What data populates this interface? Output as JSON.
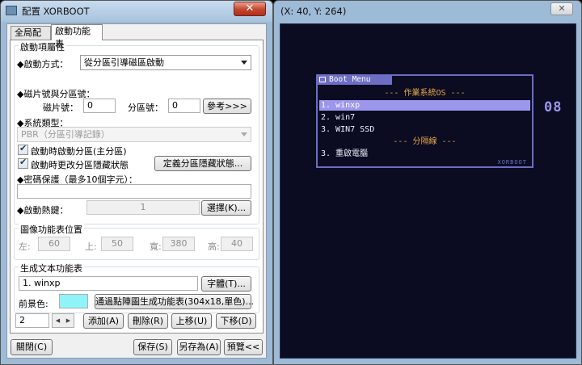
{
  "left_window": {
    "title": "配置 XORBOOT",
    "close_glyph": "✕",
    "tabs": [
      {
        "label": "全局配置",
        "active": false
      },
      {
        "label": "啟動功能表",
        "active": true
      }
    ],
    "boot_props": {
      "group_label": "啟動項屬性",
      "mode_label": "◆啟動方式：",
      "mode_value": "從分區引導磁區啟動",
      "disk_part_label": "◆磁片號與分區號：",
      "disk_label": "磁片號：",
      "disk_value": "0",
      "part_label": "分區號：",
      "part_value": "0",
      "ref_button": "參考>>>",
      "systype_label": "◆系統類型：",
      "systype_value": "PBR（分區引導記錄）",
      "chk_activate": "啟動時啟動分區(主分區)",
      "chk_hide": "啟動時更改分區隱藏狀態",
      "define_hide_button": "定義分區隱藏狀態...",
      "password_label": "◆密碼保護（最多10個字元）：",
      "password_value": "",
      "hotkey_label": "◆啟動熱鍵：",
      "hotkey_value": "1",
      "select_button": "選擇(K)..."
    },
    "image_menu": {
      "group_label": "圖像功能表位置",
      "left_label": "左:",
      "left_value": "60",
      "top_label": "上:",
      "top_value": "50",
      "width_label": "寬:",
      "width_value": "380",
      "height_label": "高:",
      "height_value": "40"
    },
    "text_menu": {
      "group_label": "生成文本功能表",
      "entry_value": "1. winxp",
      "font_button": "字體(T)...",
      "fg_label": "前景色:",
      "fg_color": "#8ff3f7",
      "gen_button": "通過點陣圖生成功能表(304x18,單色)..."
    },
    "bottom_row": {
      "index_value": "2",
      "spin_left": "◀",
      "spin_right": "▶",
      "add": "添加(A)",
      "delete": "刪除(R)",
      "up": "上移(U)",
      "down": "下移(D)"
    },
    "footer": {
      "close": "關閉(C)",
      "save": "保存(S)",
      "save_as": "另存為(A)",
      "preview": "預覽<<"
    }
  },
  "right_window": {
    "coords": "(X: 40, Y: 264)",
    "close_glyph": "✕",
    "boot_menu": {
      "title": "Boot Menu",
      "accent": "#6d6dc4",
      "highlight": "#9c97ec",
      "rows": [
        {
          "text": "--- 作業系統OS ---",
          "kind": "sep"
        },
        {
          "text": "1. winxp",
          "kind": "item",
          "selected": true
        },
        {
          "text": "2. win7",
          "kind": "item"
        },
        {
          "text": "3. WIN7 SSD",
          "kind": "item"
        },
        {
          "text": "--- 分隔線 ---",
          "kind": "sep"
        },
        {
          "text": "3. 重啟電腦",
          "kind": "item"
        }
      ],
      "footer": "XORBOOT",
      "countdown": "08"
    }
  }
}
